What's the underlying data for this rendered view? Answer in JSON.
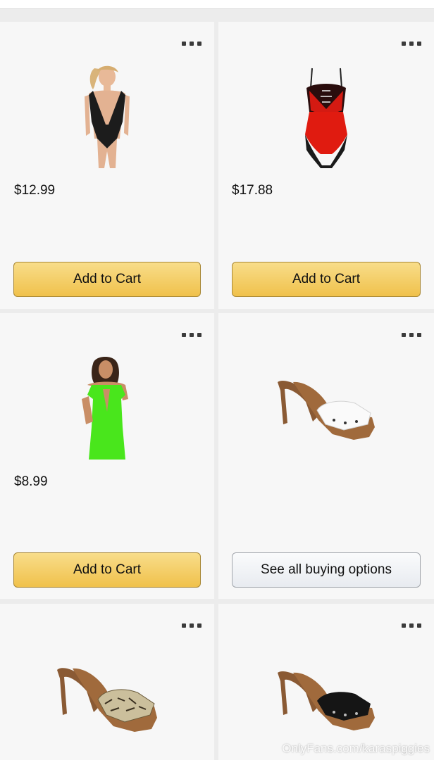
{
  "products": [
    {
      "price": "$12.99",
      "button_label": "Add to Cart",
      "button_style": "primary",
      "image": "black-lace-bodysuit"
    },
    {
      "price": "$17.88",
      "button_label": "Add to Cart",
      "button_style": "primary",
      "image": "red-lace-bodysuit"
    },
    {
      "price": "$8.99",
      "button_label": "Add to Cart",
      "button_style": "primary",
      "image": "green-fishnet-dress"
    },
    {
      "price": "",
      "button_label": "See all buying options",
      "button_style": "secondary",
      "image": "white-wooden-clog-heel"
    },
    {
      "image": "snakeskin-wooden-clog-heel"
    },
    {
      "image": "black-wooden-clog-heel"
    }
  ],
  "watermark": "OnlyFans.com/karaspiggies",
  "colors": {
    "add_to_cart": "#f0c14b",
    "secondary_button": "#e8ebf0",
    "card_background": "#f7f7f7"
  }
}
